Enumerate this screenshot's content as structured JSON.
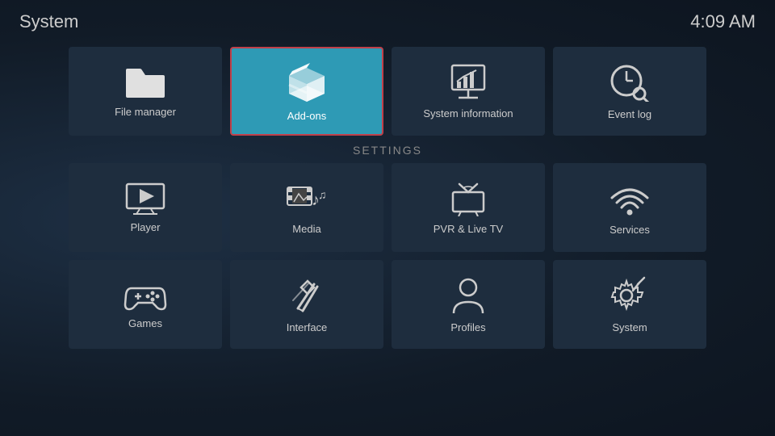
{
  "header": {
    "title": "System",
    "time": "4:09 AM"
  },
  "settings_label": "Settings",
  "top_row": [
    {
      "id": "file-manager",
      "label": "File manager",
      "icon": "folder"
    },
    {
      "id": "add-ons",
      "label": "Add-ons",
      "icon": "box",
      "active": true
    },
    {
      "id": "system-information",
      "label": "System information",
      "icon": "presentation"
    },
    {
      "id": "event-log",
      "label": "Event log",
      "icon": "clock-search"
    }
  ],
  "settings_row1": [
    {
      "id": "player",
      "label": "Player",
      "icon": "play-screen"
    },
    {
      "id": "media",
      "label": "Media",
      "icon": "film-music"
    },
    {
      "id": "pvr",
      "label": "PVR & Live TV",
      "icon": "tv-antenna"
    },
    {
      "id": "services",
      "label": "Services",
      "icon": "wifi-dots"
    }
  ],
  "settings_row2": [
    {
      "id": "games",
      "label": "Games",
      "icon": "gamepad"
    },
    {
      "id": "interface",
      "label": "Interface",
      "icon": "pencil-diamond"
    },
    {
      "id": "profiles",
      "label": "Profiles",
      "icon": "person"
    },
    {
      "id": "system",
      "label": "System",
      "icon": "gear-fork"
    }
  ]
}
